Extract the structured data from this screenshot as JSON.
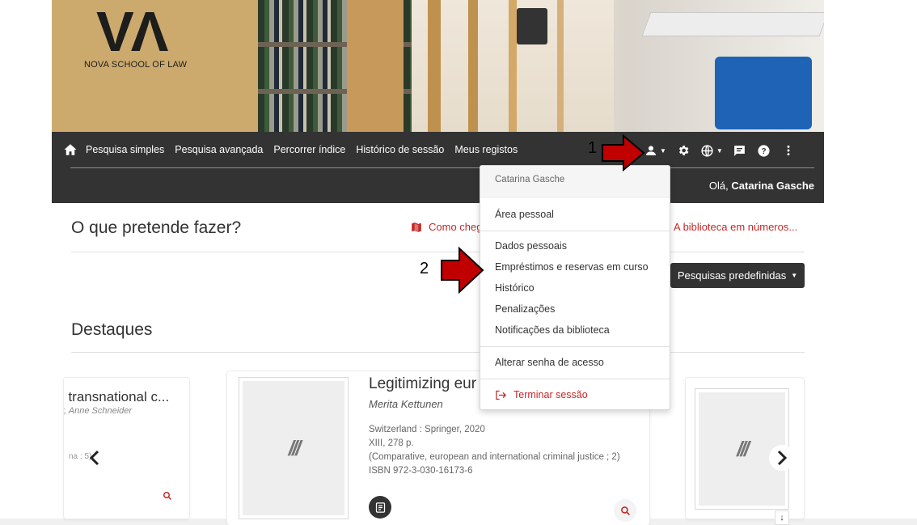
{
  "brand": {
    "logo_mark": "VΛ",
    "logo_text": "NOVA SCHOOL OF LAW"
  },
  "nav": {
    "links": [
      "Pesquisa simples",
      "Pesquisa avançada",
      "Percorrer índice",
      "Histórico de sessão",
      "Meus registos"
    ],
    "icons": [
      "home-icon",
      "user-icon",
      "gear-icon",
      "globe-icon",
      "chat-icon",
      "help-icon",
      "more-vert-icon"
    ]
  },
  "greeting": {
    "prefix": "Olá, ",
    "user": "Catarina Gasche"
  },
  "main": {
    "question": "O que pretende fazer?",
    "map_link": "Como chegar",
    "stats_link": "A biblioteca em números...",
    "predef_button": "Pesquisas predefinidas",
    "highlights": "Destaques"
  },
  "carousel": {
    "left_card": {
      "title": "ı transnational c...",
      "author": "r, Anne Schneider",
      "meta": "na : 5)"
    },
    "center_card": {
      "title": "Legitimizing eur",
      "author": "Merita Kettunen",
      "publisher": "Switzerland : Springer, 2020",
      "pages": "XIII, 278 p.",
      "series": "(Comparative, european and international criminal justice ; 2)",
      "isbn": "ISBN 972-3-030-16173-6"
    }
  },
  "dropdown": {
    "header": "Catarina Gasche",
    "personal_area": "Área pessoal",
    "items": [
      "Dados pessoais",
      "Empréstimos e reservas em curso",
      "Histórico",
      "Penalizações",
      "Notificações da biblioteca"
    ],
    "change_password": "Alterar senha de acesso",
    "logout": "Terminar sessão"
  },
  "annotations": {
    "step1": "1",
    "step2": "2",
    "arrow_color": "#c00000"
  },
  "colors": {
    "navbar": "#333333",
    "accent": "#c62828"
  }
}
